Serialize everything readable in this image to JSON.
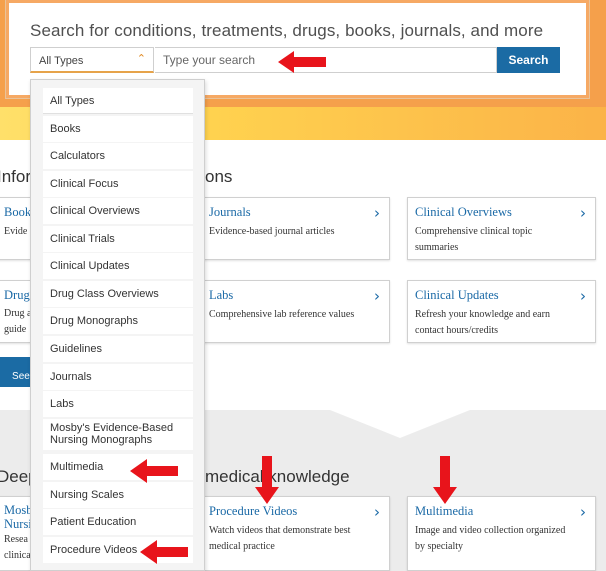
{
  "search": {
    "heading": "Search for conditions, treatments, drugs, books, journals, and more",
    "type_selected": "All Types",
    "placeholder": "Type your search",
    "button_label": "Search"
  },
  "sections": {
    "info_title_left": "Infor",
    "info_title_right": "ons",
    "deep_title_left": "Deep",
    "deep_title_right": "medical knowledge",
    "see_more_label": "See r"
  },
  "cards": {
    "books": {
      "title": "Book",
      "desc": "Evide"
    },
    "journals": {
      "title": "Journals",
      "desc": "Evidence-based journal articles"
    },
    "clinical_overviews": {
      "title": "Clinical Overviews",
      "desc": "Comprehensive clinical topic summaries"
    },
    "drugs": {
      "title": "Drug",
      "desc_line1": "Drug a",
      "desc_line2": "guide"
    },
    "labs": {
      "title": "Labs",
      "desc": "Comprehensive lab reference values"
    },
    "clinical_updates": {
      "title": "Clinical Updates",
      "desc": "Refresh your knowledge and earn contact hours/credits"
    },
    "mosby": {
      "title_line1": "Mosb",
      "title_line2": "Nursi",
      "desc_line1": "Resea",
      "desc_line2": "clinica"
    },
    "procedure_videos": {
      "title": "Procedure Videos",
      "desc": "Watch videos that demonstrate best medical practice"
    },
    "multimedia": {
      "title": "Multimedia",
      "desc": "Image and video collection organized by specialty"
    }
  },
  "dropdown": {
    "items": [
      "All Types",
      "Books",
      "Calculators",
      "Clinical Focus",
      "Clinical Overviews",
      "Clinical Trials",
      "Clinical Updates",
      "Drug Class Overviews",
      "Drug Monographs",
      "Guidelines",
      "Journals",
      "Labs",
      "Mosby's Evidence-Based Nursing Monographs",
      "Multimedia",
      "Nursing Scales",
      "Patient Education",
      "Procedure Videos"
    ]
  },
  "icons": {
    "select_caret": "chevron-up-icon",
    "card_chevron": "chevron-right-icon",
    "annotation": "red-arrow-icon"
  },
  "colors": {
    "accent_orange": "#f5a04b",
    "brand_blue": "#1b6ba4",
    "link_blue": "#1a69a6",
    "annotation_red": "#e8141b"
  }
}
